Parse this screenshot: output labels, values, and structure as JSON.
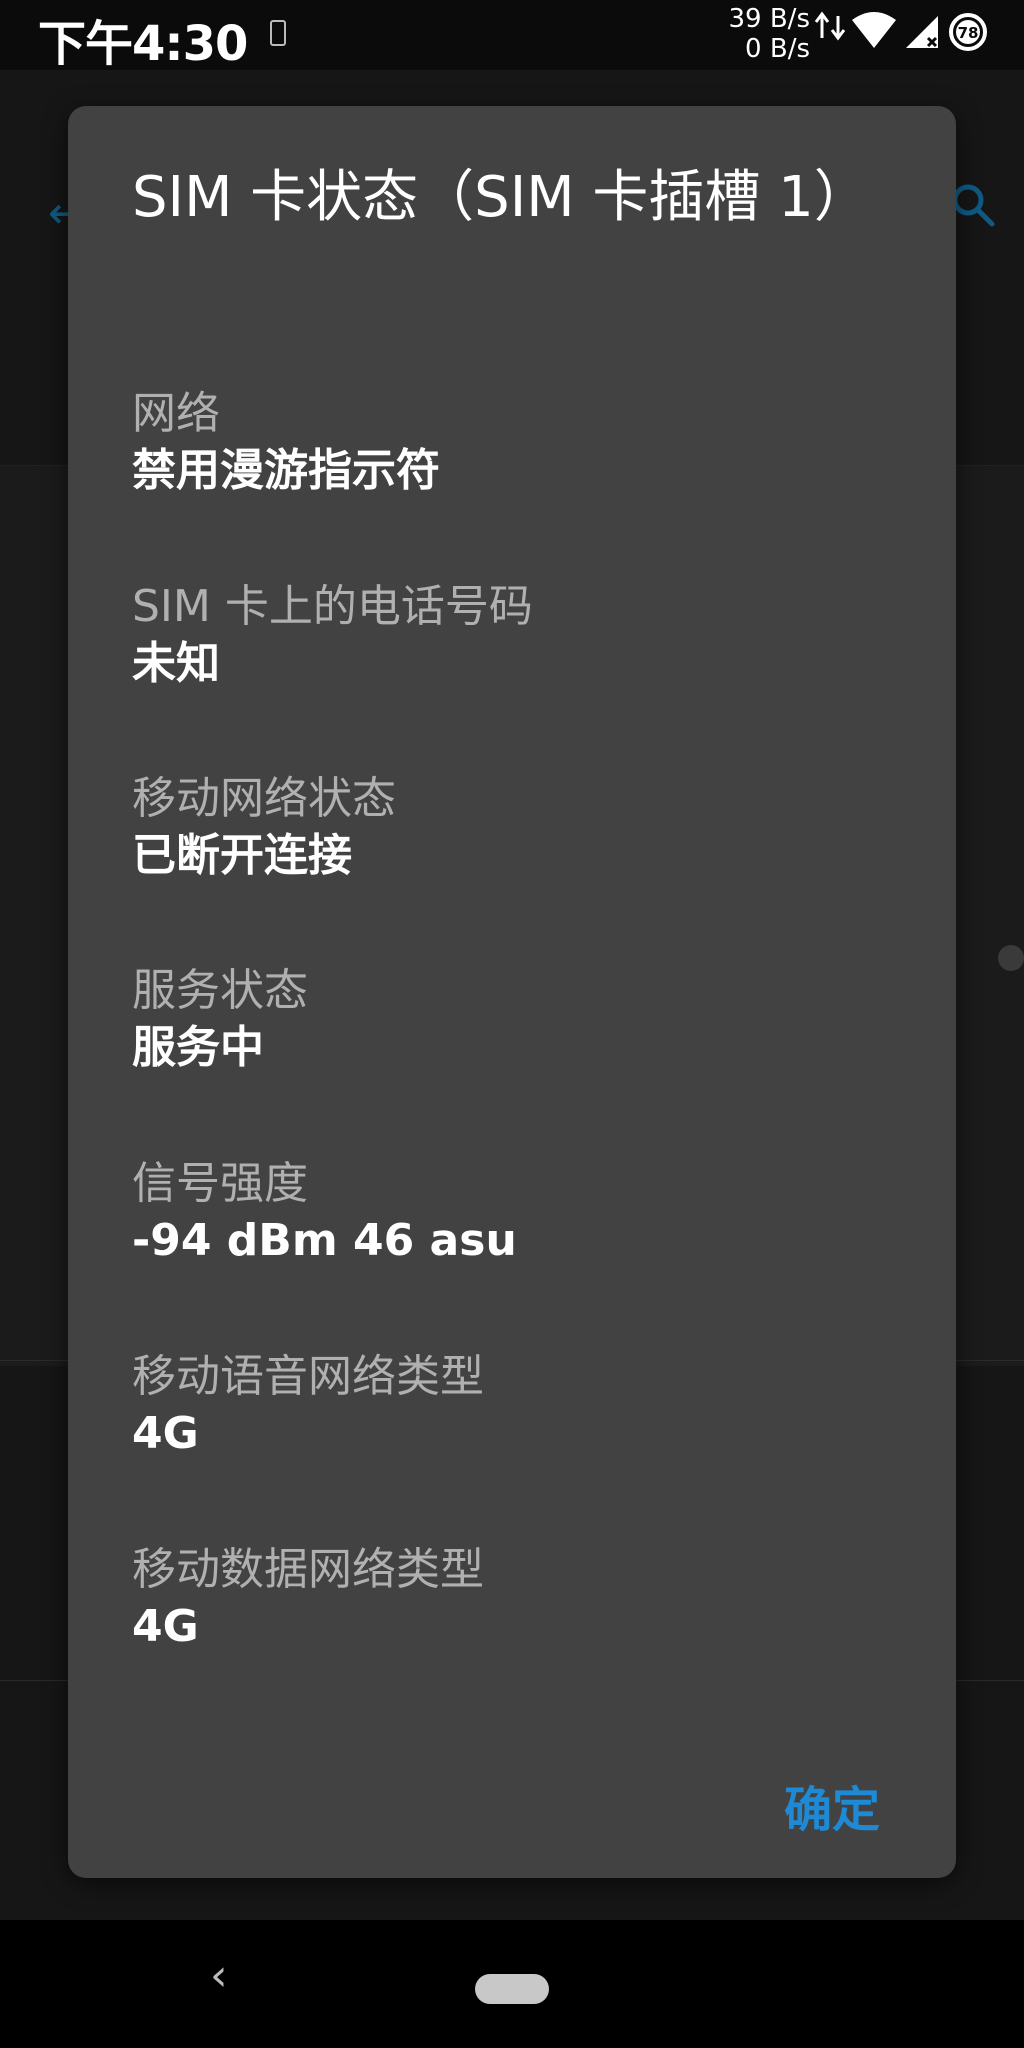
{
  "status_bar": {
    "time": "下午4:30",
    "speed_up": "39 B/s",
    "speed_down": "0 B/s",
    "battery": "78"
  },
  "dialog": {
    "title": "SIM 卡状态（SIM 卡插槽 1）",
    "rows": [
      {
        "label": "网络",
        "value": "禁用漫游指示符"
      },
      {
        "label": "SIM 卡上的电话号码",
        "value": "未知"
      },
      {
        "label": "移动网络状态",
        "value": "已断开连接"
      },
      {
        "label": "服务状态",
        "value": "服务中"
      },
      {
        "label": "信号强度",
        "value": "-94 dBm 46 asu"
      },
      {
        "label": "移动语音网络类型",
        "value": "4G"
      },
      {
        "label": "移动数据网络类型",
        "value": "4G"
      }
    ],
    "ok_label": "确定"
  },
  "nav": {
    "back_icon": "chevron-left-icon",
    "home_icon": "home-pill-icon"
  },
  "colors": {
    "accent": "#1e8ad6",
    "dialog_bg": "#424242",
    "label": "#b0b0b0"
  }
}
